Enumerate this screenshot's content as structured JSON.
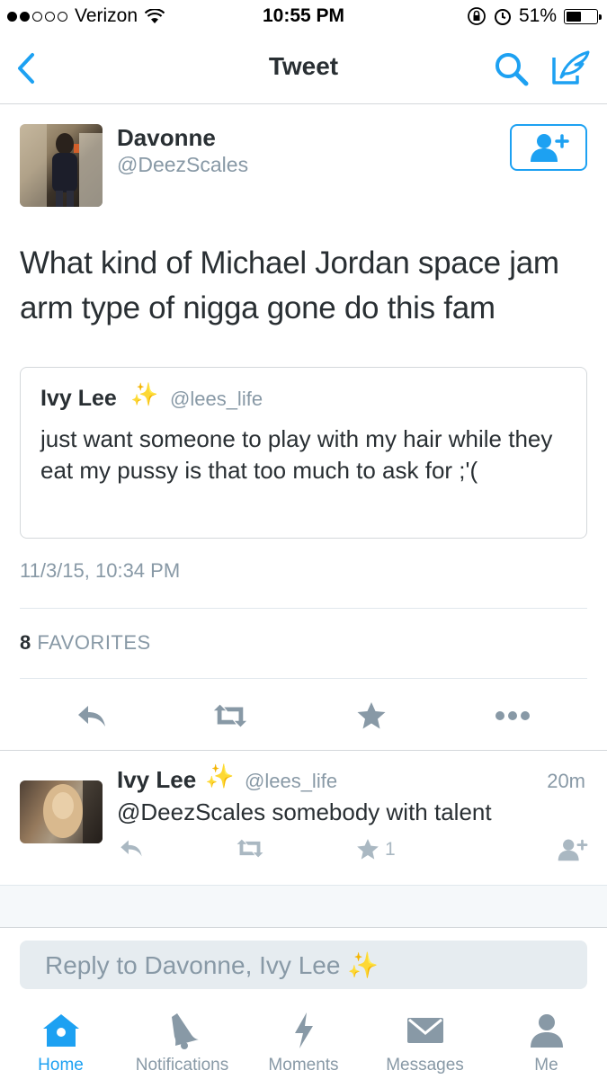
{
  "status_bar": {
    "carrier": "Verizon",
    "time": "10:55 PM",
    "battery": "51%",
    "battery_level": 0.51
  },
  "nav": {
    "title": "Tweet",
    "back_icon": "chevron-left-icon",
    "search_icon": "search-icon",
    "compose_icon": "compose-icon"
  },
  "tweet": {
    "author_name": "Davonne",
    "author_handle": "@DeezScales",
    "text": "What kind of Michael Jordan space jam arm type of nigga gone do this fam",
    "timestamp": "11/3/15, 10:34 PM",
    "favorites_count": "8",
    "favorites_label": "FAVORITES",
    "quote": {
      "name": "Ivy Lee",
      "sparkle": "✨",
      "handle": "@lees_life",
      "text": "just want someone to play with my hair while they eat my pussy is that too much to ask for ;'("
    }
  },
  "reply": {
    "name": "Ivy Lee",
    "sparkle": "✨",
    "handle": "@lees_life",
    "time": "20m",
    "text": "@DeezScales somebody with talent",
    "like_count": "1"
  },
  "reply_box": {
    "placeholder": "Reply to Davonne, Ivy Lee ✨"
  },
  "tabs": [
    {
      "label": "Home",
      "icon": "home-icon",
      "active": true
    },
    {
      "label": "Notifications",
      "icon": "bell-icon",
      "active": false
    },
    {
      "label": "Moments",
      "icon": "lightning-icon",
      "active": false
    },
    {
      "label": "Messages",
      "icon": "envelope-icon",
      "active": false
    },
    {
      "label": "Me",
      "icon": "person-icon",
      "active": false
    }
  ],
  "colors": {
    "accent": "#1da1f2",
    "muted": "#8899a6",
    "text": "#292f33",
    "sparkle": "#f5c518"
  }
}
